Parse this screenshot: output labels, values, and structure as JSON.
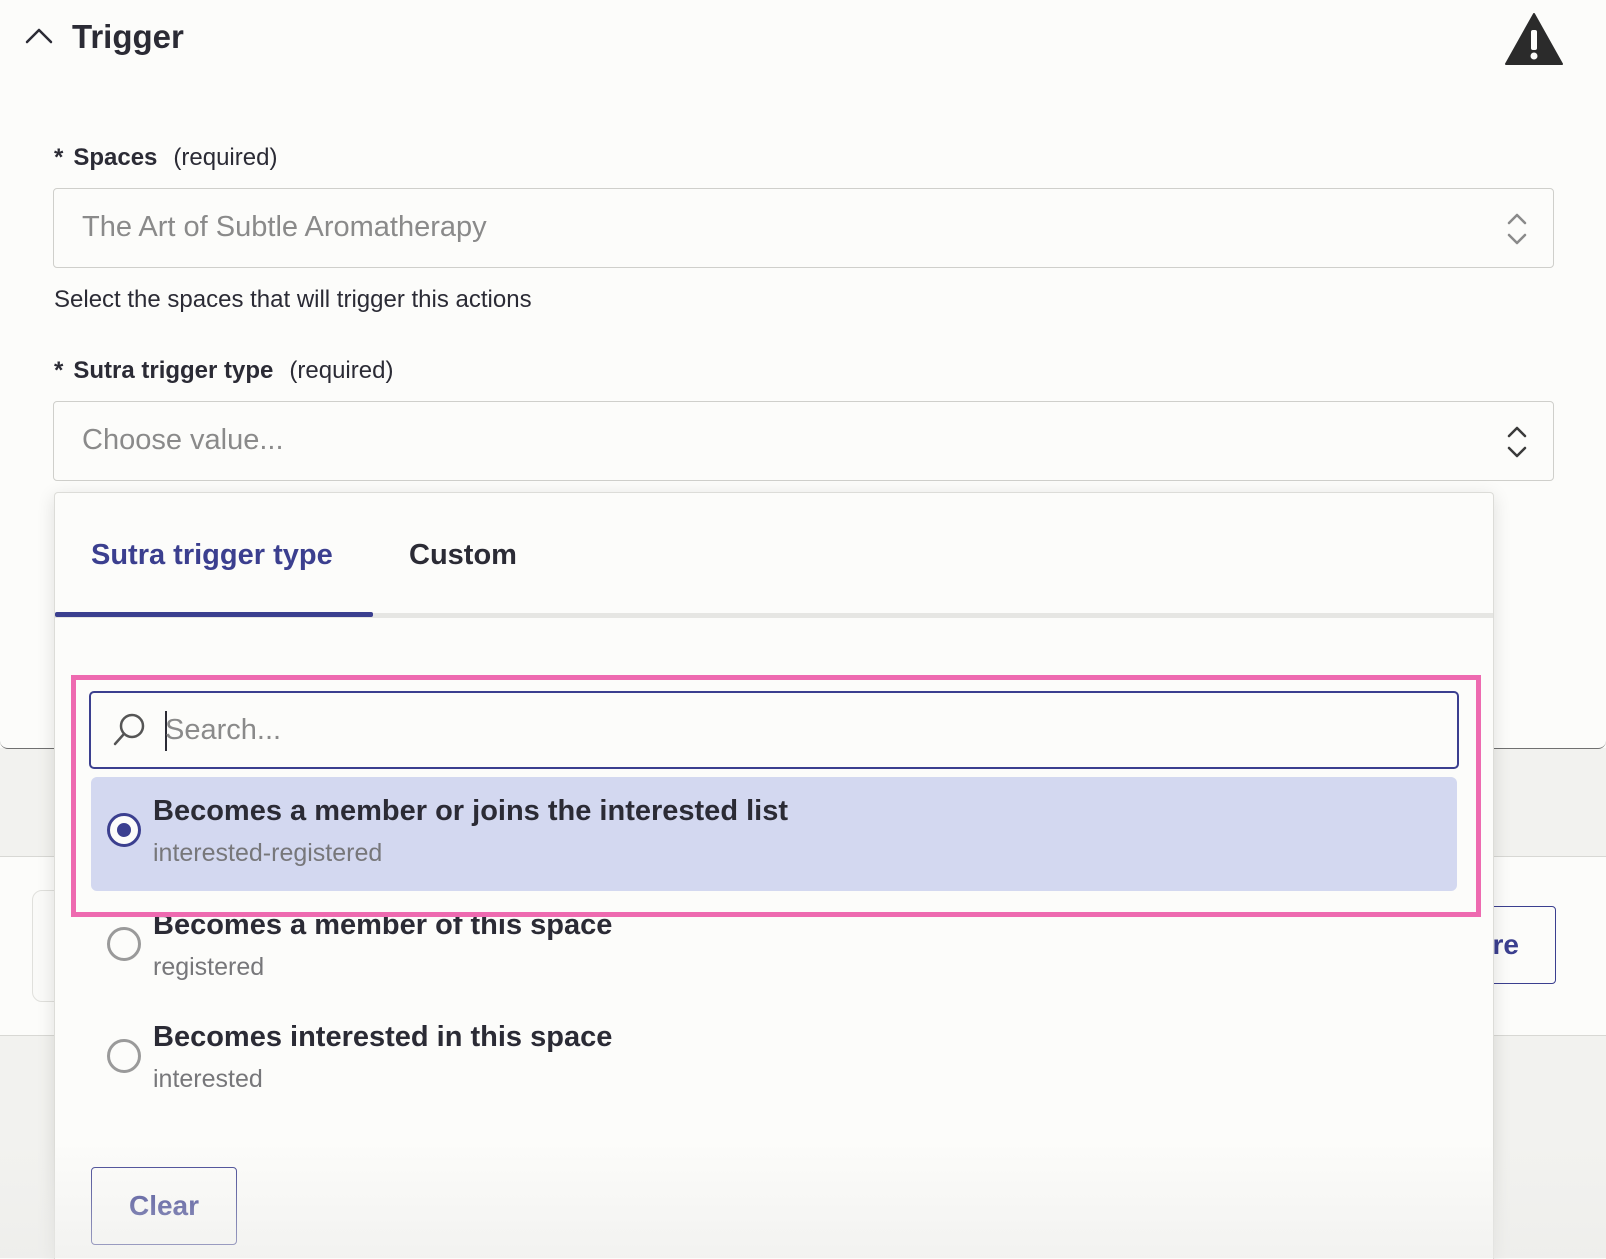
{
  "section": {
    "title": "Trigger",
    "collapse_icon": "chevron-up-icon",
    "warning_icon": "warning-triangle-icon"
  },
  "spaces": {
    "required_marker": "*",
    "label": "Spaces",
    "required_text": "(required)",
    "value": "The Art of Subtle Aromatherapy",
    "help": "Select the spaces that will trigger this actions"
  },
  "trigger_type": {
    "required_marker": "*",
    "label": "Sutra trigger type",
    "required_text": "(required)",
    "placeholder": "Choose value..."
  },
  "dropdown": {
    "tabs": [
      {
        "label": "Sutra trigger type",
        "active": true
      },
      {
        "label": "Custom",
        "active": false
      }
    ],
    "search_placeholder": "Search...",
    "options": [
      {
        "title": "Becomes a member or joins the interested list",
        "value": "interested-registered",
        "selected": true
      },
      {
        "title": "Becomes a member of this space",
        "value": "registered",
        "selected": false
      },
      {
        "title": "Becomes interested in this space",
        "value": "interested",
        "selected": false
      }
    ],
    "clear_label": "Clear"
  },
  "background": {
    "partial_button_text": "re"
  },
  "colors": {
    "accent": "#3b3f8f",
    "selected_bg": "#d3d8f0",
    "highlight": "#ee6ab0",
    "warning": "#2b2b2b"
  }
}
